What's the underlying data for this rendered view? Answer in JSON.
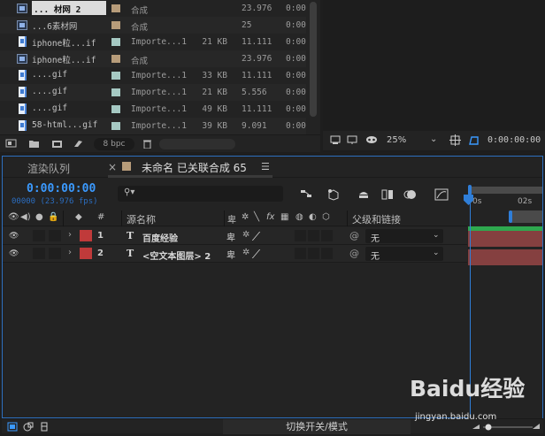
{
  "project": {
    "rows": [
      {
        "name": "... 材网 2",
        "kind": "comp",
        "swatch": "#b79c7a",
        "type": "合成",
        "size": "",
        "fps": "23.976",
        "dur": "0:00"
      },
      {
        "name": "...6素材网",
        "kind": "comp",
        "swatch": "#b79c7a",
        "type": "合成",
        "size": "",
        "fps": "25",
        "dur": "0:00"
      },
      {
        "name": "iphone粒...if",
        "kind": "file",
        "swatch": "#a6c9c3",
        "type": "Importe...1",
        "size": "21 KB",
        "fps": "11.111",
        "dur": "0:00"
      },
      {
        "name": "iphone粒...if",
        "kind": "comp",
        "swatch": "#b79c7a",
        "type": "合成",
        "size": "",
        "fps": "23.976",
        "dur": "0:00"
      },
      {
        "name": "....gif",
        "kind": "file",
        "swatch": "#a6c9c3",
        "type": "Importe...1",
        "size": "33 KB",
        "fps": "11.111",
        "dur": "0:00"
      },
      {
        "name": "....gif",
        "kind": "file",
        "swatch": "#a6c9c3",
        "type": "Importe...1",
        "size": "21 KB",
        "fps": "5.556",
        "dur": "0:00"
      },
      {
        "name": "....gif",
        "kind": "file",
        "swatch": "#a6c9c3",
        "type": "Importe...1",
        "size": "49 KB",
        "fps": "11.111",
        "dur": "0:00"
      },
      {
        "name": "58-html...gif",
        "kind": "file",
        "swatch": "#a6c9c3",
        "type": "Importe...1",
        "size": "39 KB",
        "fps": "9.091",
        "dur": "0:00"
      }
    ],
    "bpc": "8 bpc"
  },
  "viewer": {
    "zoom": "25%",
    "timecode": "0:00:00:00"
  },
  "timeline": {
    "tab_render": "渲染队列",
    "tab_close": "×",
    "tab_comp": "未命名 已关联合成 65",
    "tab_menu": "☰",
    "timecode": "0:00:00:00",
    "frames": "00000 (23.976 fps)",
    "columns": {
      "number": "#",
      "source_name": "源名称",
      "parent": "父级和链接"
    },
    "layers": [
      {
        "num": "1",
        "type_icon": "T",
        "name": "百度经验",
        "parent": "无"
      },
      {
        "num": "2",
        "type_icon": "T",
        "name": "<空文本图层> 2",
        "parent": "无"
      }
    ],
    "ruler": [
      "0s",
      "02s"
    ],
    "switch_modes": "切换开关/模式"
  },
  "watermark": {
    "logo": "Baidu经验",
    "url": "jingyan.baidu.com"
  },
  "colors": {
    "accent_blue": "#2f7ed8",
    "timecode_blue": "#3b9aff",
    "label_red": "#c03a3a",
    "comp_swatch": "#b79c7a",
    "file_swatch": "#a6c9c3",
    "work_area_green": "#2ea84f"
  }
}
